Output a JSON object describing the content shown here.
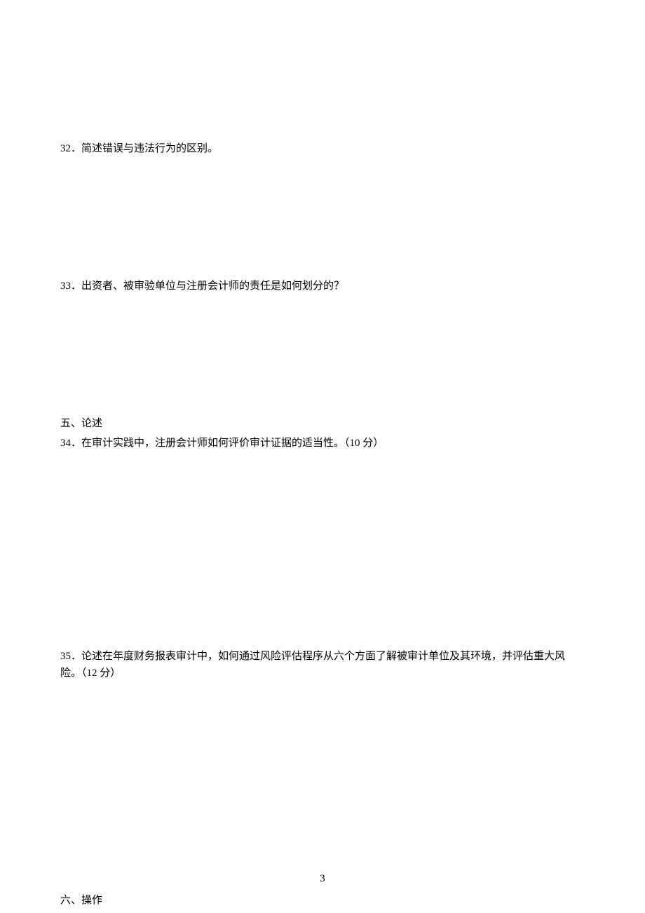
{
  "questions": {
    "q32": "32．简述错误与违法行为的区别。",
    "q33": "33．出资者、被审验单位与注册会计师的责任是如何划分的？",
    "section5": "五、论述",
    "q34": "34．在审计实践中，注册会计师如何评价审计证据的适当性。（10 分）",
    "q35": "35．论述在年度财务报表审计中，如何通过风险评估程序从六个方面了解被审计单位及其环境，并评估重大风险。（12 分）",
    "section6": "六、操作"
  },
  "page_number": "3"
}
